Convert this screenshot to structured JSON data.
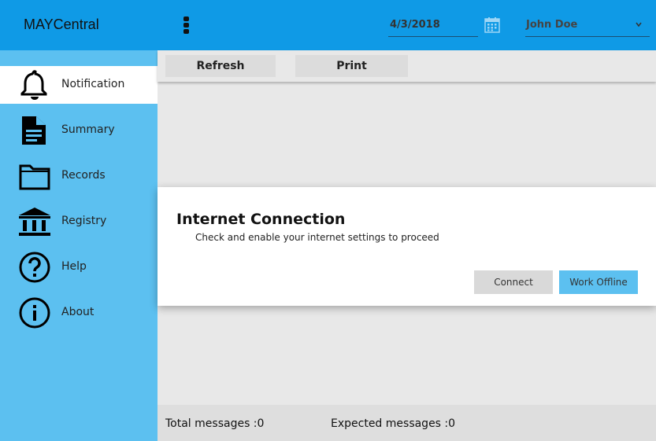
{
  "header": {
    "app_title": "MAYCentral",
    "date_value": "4/3/2018",
    "user_selected": "John Doe",
    "accent_color": "#0f9ae6"
  },
  "sidebar": {
    "items": [
      {
        "label": "Notification",
        "icon": "bell-icon",
        "active": true
      },
      {
        "label": "Summary",
        "icon": "document-icon"
      },
      {
        "label": "Records",
        "icon": "folder-icon"
      },
      {
        "label": "Registry",
        "icon": "bank-icon"
      },
      {
        "label": "Help",
        "icon": "help-circle-icon"
      },
      {
        "label": "About",
        "icon": "info-circle-icon"
      }
    ]
  },
  "toolbar": {
    "refresh_label": "Refresh",
    "print_label": "Print"
  },
  "dialog": {
    "title": "Internet Connection",
    "message": "Check and enable your internet settings to proceed",
    "connect_label": "Connect",
    "offline_label": "Work Offline"
  },
  "footer": {
    "total_messages": "Total messages :0",
    "expected_messages": "Expected messages :0"
  }
}
